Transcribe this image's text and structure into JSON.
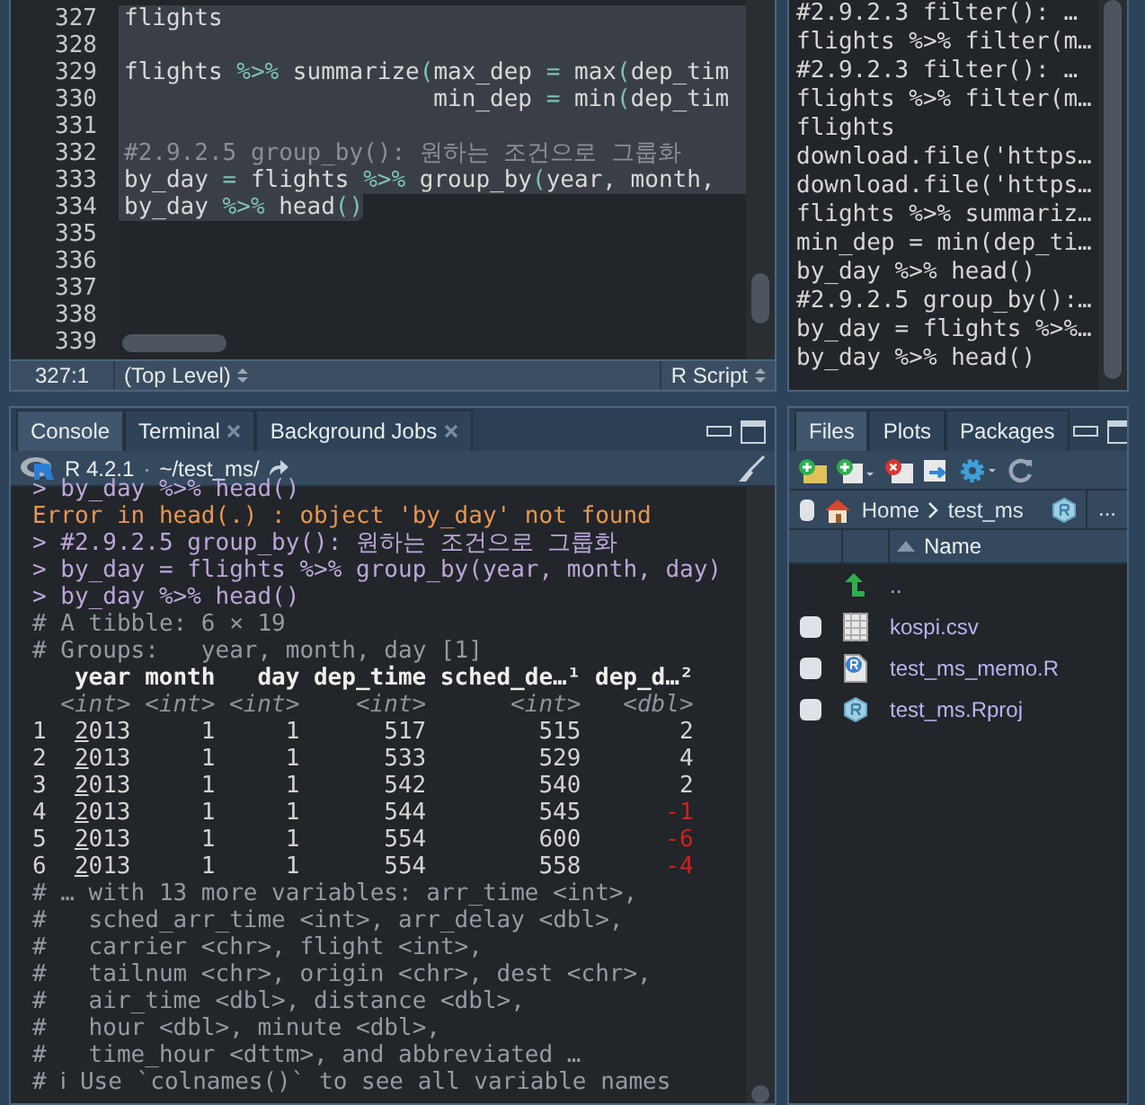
{
  "editor": {
    "lines": [
      {
        "number": "327",
        "selected": true,
        "segments": [
          {
            "text": "flights",
            "kind": "plain"
          }
        ]
      },
      {
        "number": "328",
        "selected": true
      },
      {
        "number": "329",
        "selected": true,
        "segments": [
          {
            "text": "flights ",
            "kind": "plain"
          },
          {
            "text": "%>%",
            "kind": "op"
          },
          {
            "text": " summarize",
            "kind": "plain"
          },
          {
            "text": "(",
            "kind": "op"
          },
          {
            "text": "max_dep ",
            "kind": "plain"
          },
          {
            "text": "=",
            "kind": "op"
          },
          {
            "text": " max",
            "kind": "plain"
          },
          {
            "text": "(",
            "kind": "op"
          },
          {
            "text": "dep_tim",
            "kind": "plain"
          }
        ]
      },
      {
        "number": "330",
        "selected": true,
        "segments": [
          {
            "text": "                      min_dep ",
            "kind": "plain"
          },
          {
            "text": "=",
            "kind": "op"
          },
          {
            "text": " min",
            "kind": "plain"
          },
          {
            "text": "(",
            "kind": "op"
          },
          {
            "text": "dep_tim",
            "kind": "plain"
          }
        ]
      },
      {
        "number": "331",
        "selected": true
      },
      {
        "number": "332",
        "selected": true,
        "segments": [
          {
            "text": "#2.9.2.5 group_by(): 원하는 조건으로 그룹화",
            "kind": "comment"
          }
        ]
      },
      {
        "number": "333",
        "selected": true,
        "segments": [
          {
            "text": "by_day ",
            "kind": "plain"
          },
          {
            "text": "=",
            "kind": "op"
          },
          {
            "text": " flights ",
            "kind": "plain"
          },
          {
            "text": "%>%",
            "kind": "op"
          },
          {
            "text": " group_by",
            "kind": "plain"
          },
          {
            "text": "(",
            "kind": "op"
          },
          {
            "text": "year, month,",
            "kind": "plain"
          }
        ]
      },
      {
        "number": "334",
        "selected": true,
        "segments": [
          {
            "text": "by_day ",
            "kind": "plain"
          },
          {
            "text": "%>%",
            "kind": "op"
          },
          {
            "text": " head",
            "kind": "plain"
          },
          {
            "text": "()",
            "kind": "op"
          }
        ]
      },
      {
        "number": "335",
        "selected": false
      },
      {
        "number": "336",
        "selected": false
      },
      {
        "number": "337",
        "selected": false
      },
      {
        "number": "338",
        "selected": false
      },
      {
        "number": "339",
        "selected": false
      }
    ],
    "status": {
      "position": "327:1",
      "scope": "(Top Level)",
      "file_type": "R Script"
    }
  },
  "history": [
    "#2.9.2.3 filter(): …",
    "flights %>% filter(m…",
    "#2.9.2.3 filter(): …",
    "flights %>% filter(m…",
    "flights",
    "download.file('https…",
    "download.file('https…",
    "flights %>% summariz…",
    "min_dep = min(dep_ti…",
    "by_day %>% head()",
    "#2.9.2.5 group_by():…",
    "by_day = flights %>%…",
    "by_day %>% head()"
  ],
  "console": {
    "tabs": [
      {
        "label": "Console",
        "selected": true,
        "closable": false
      },
      {
        "label": "Terminal",
        "selected": false,
        "closable": true
      },
      {
        "label": "Background Jobs",
        "selected": false,
        "closable": true
      }
    ],
    "version": "R 4.2.1",
    "separator": "·",
    "path": "~/test_ms/",
    "before": [
      {
        "kind": "echo",
        "text": "> by_day %>% head()"
      },
      {
        "kind": "error",
        "text": "Error in head(.) : object 'by_day' not found"
      },
      {
        "kind": "echo",
        "text": "> #2.9.2.5 group_by(): 원하는 조건으로 그룹화"
      },
      {
        "kind": "echo",
        "text": "> by_day = flights %>% group_by(year, month, day)"
      },
      {
        "kind": "echo",
        "text": "> by_day %>% head()"
      },
      {
        "kind": "comment",
        "text": "# A tibble: 6 × 19"
      },
      {
        "kind": "comment",
        "text": "# Groups:   year, month, day [1]"
      }
    ],
    "tibble": {
      "columns": [
        {
          "name": "year",
          "type": "<int>"
        },
        {
          "name": "month",
          "type": "<int>"
        },
        {
          "name": "day",
          "type": "<int>"
        },
        {
          "name": "dep_time",
          "type": "<int>"
        },
        {
          "name": "sched_de…¹",
          "type": "<int>"
        },
        {
          "name": "dep_d…²",
          "type": "<dbl>"
        }
      ],
      "rows": [
        {
          "index": "1",
          "cells": [
            "2013",
            "1",
            "1",
            "517",
            "515",
            "2"
          ],
          "negative": false
        },
        {
          "index": "2",
          "cells": [
            "2013",
            "1",
            "1",
            "533",
            "529",
            "4"
          ],
          "negative": false
        },
        {
          "index": "3",
          "cells": [
            "2013",
            "1",
            "1",
            "542",
            "540",
            "2"
          ],
          "negative": false
        },
        {
          "index": "4",
          "cells": [
            "2013",
            "1",
            "1",
            "544",
            "545",
            "-1"
          ],
          "negative": true
        },
        {
          "index": "5",
          "cells": [
            "2013",
            "1",
            "1",
            "554",
            "600",
            "-6"
          ],
          "negative": true
        },
        {
          "index": "6",
          "cells": [
            "2013",
            "1",
            "1",
            "554",
            "558",
            "-4"
          ],
          "negative": true
        }
      ]
    },
    "after": [
      {
        "kind": "comment",
        "text": "# … with 13 more variables: arr_time <int>,"
      },
      {
        "kind": "comment",
        "text": "#   sched_arr_time <int>, arr_delay <dbl>,"
      },
      {
        "kind": "comment",
        "text": "#   carrier <chr>, flight <int>,"
      },
      {
        "kind": "comment",
        "text": "#   tailnum <chr>, origin <chr>, dest <chr>,"
      },
      {
        "kind": "comment",
        "text": "#   air_time <dbl>, distance <dbl>,"
      },
      {
        "kind": "comment",
        "text": "#   hour <dbl>, minute <dbl>,"
      },
      {
        "kind": "comment",
        "text": "#   time_hour <dttm>, and abbreviated …"
      },
      {
        "kind": "comment",
        "text": "# ℹ Use `colnames()` to see all variable names"
      }
    ]
  },
  "files": {
    "tabs": [
      {
        "label": "Files",
        "selected": true
      },
      {
        "label": "Plots",
        "selected": false
      },
      {
        "label": "Packages",
        "selected": false
      }
    ],
    "select_all_checked": false,
    "breadcrumb": [
      "Home",
      "test_ms"
    ],
    "more": "...",
    "header": "Name",
    "parent": "..",
    "items": [
      {
        "name": "kospi.csv",
        "kind": "csv",
        "checked": false
      },
      {
        "name": "test_ms_memo.R",
        "kind": "rscript",
        "checked": false
      },
      {
        "name": "test_ms.Rproj",
        "kind": "rproj",
        "checked": false
      }
    ]
  }
}
